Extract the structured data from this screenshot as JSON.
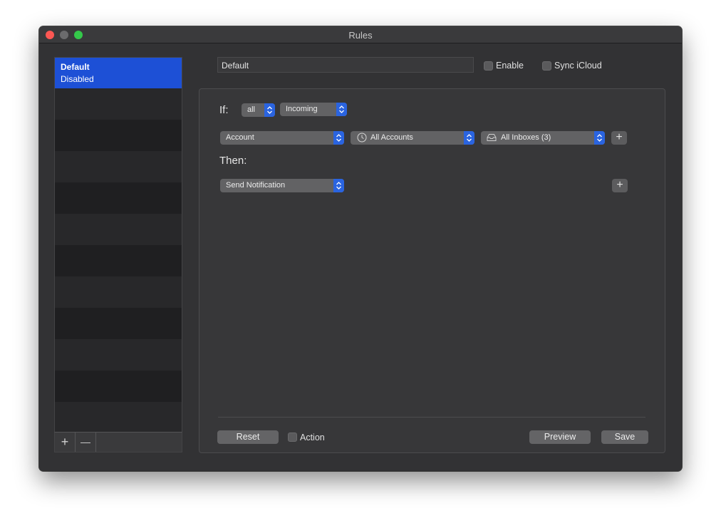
{
  "window": {
    "title": "Rules"
  },
  "sidebar": {
    "rules": [
      {
        "name": "Default",
        "status": "Disabled"
      }
    ],
    "add_label": "+",
    "remove_label": "—"
  },
  "header": {
    "rule_name_value": "Default",
    "enable_label": "Enable",
    "sync_label": "Sync iCloud"
  },
  "conditions": {
    "if_label": "If:",
    "match_value": "all",
    "trigger_value": "Incoming",
    "rows": [
      {
        "field": "Account",
        "operator": "All Accounts",
        "operator_icon": "clock-icon",
        "value": "All Inboxes (3)",
        "value_icon": "inbox-icon"
      }
    ],
    "add_label": "+"
  },
  "actions": {
    "then_label": "Then:",
    "rows": [
      {
        "action": "Send Notification"
      }
    ],
    "add_label": "+"
  },
  "footer": {
    "reset_label": "Reset",
    "action_checkbox_label": "Action",
    "preview_label": "Preview",
    "save_label": "Save"
  },
  "colors": {
    "accent": "#1d50d6",
    "stepper": "#2a64e0",
    "window_bg": "#323234"
  }
}
